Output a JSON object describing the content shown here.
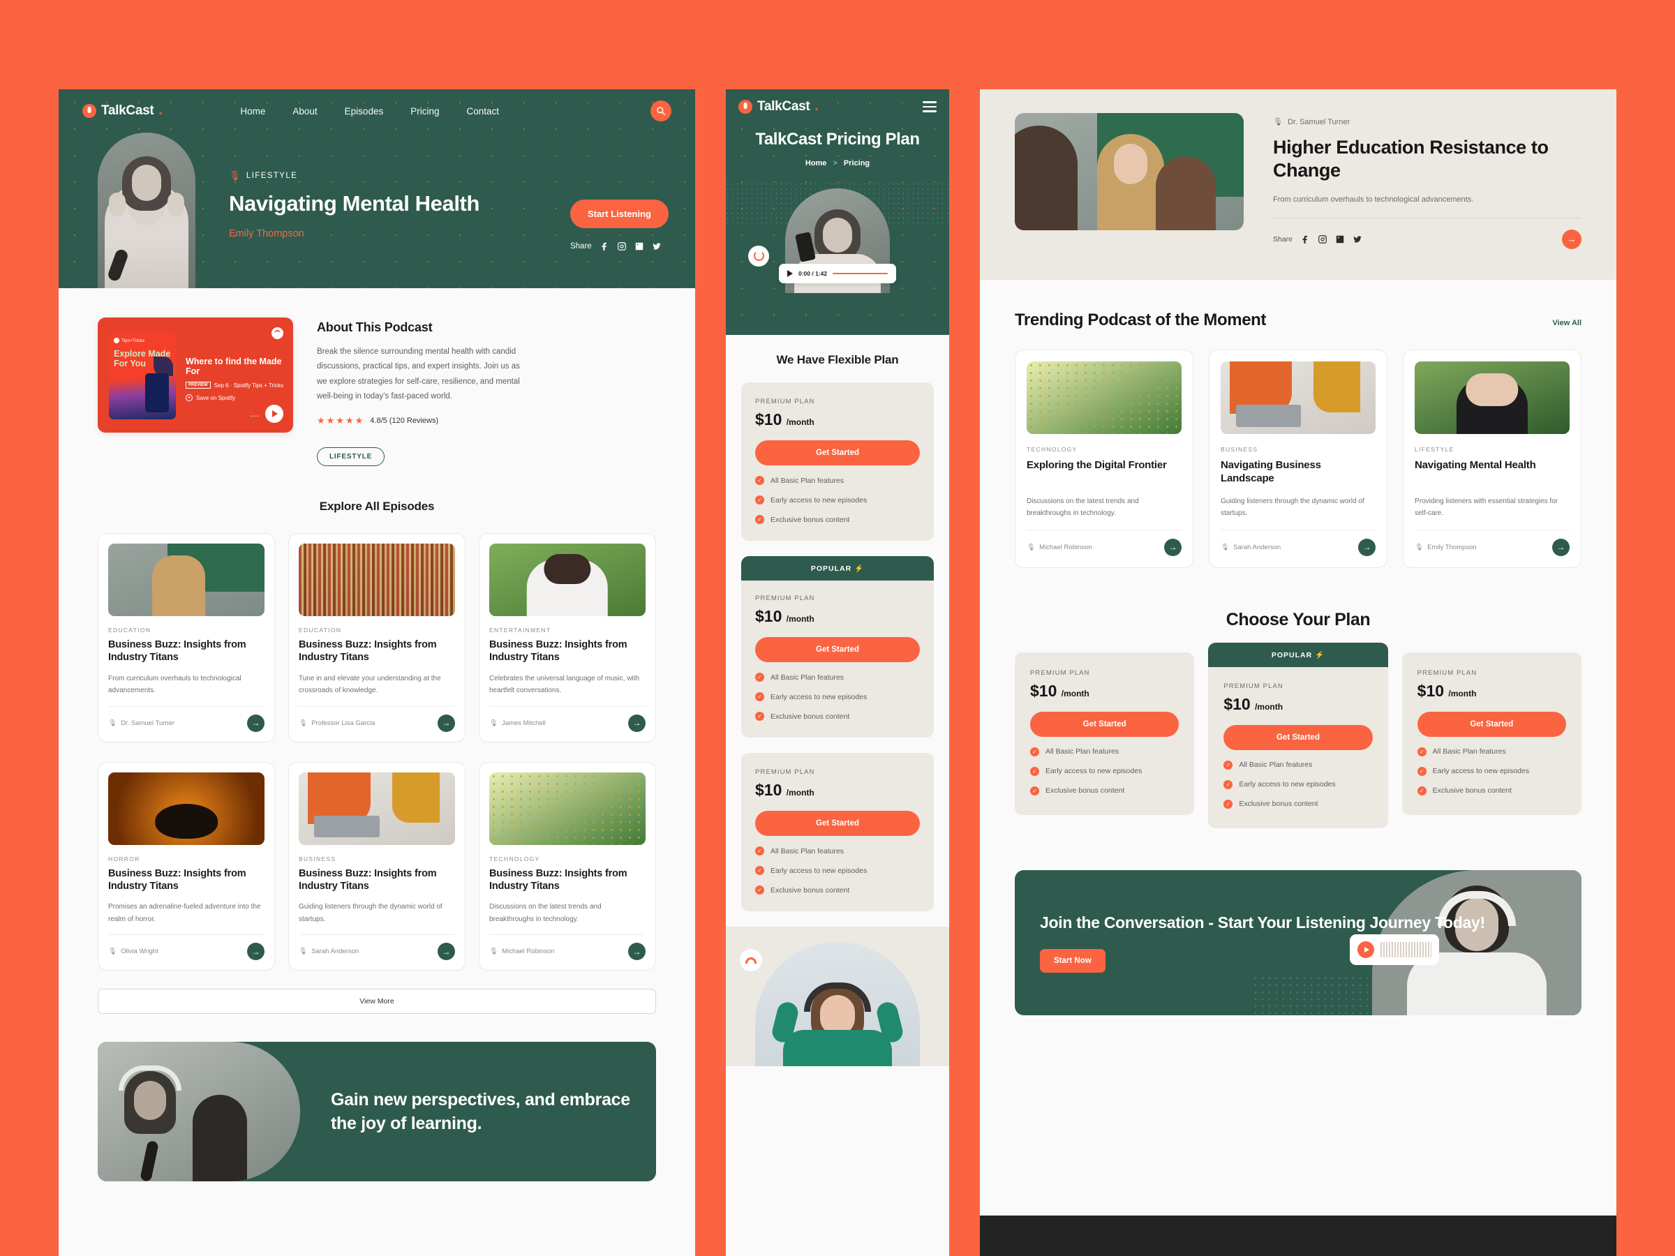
{
  "colors": {
    "background": "#fa6440",
    "green": "#2e5b4e",
    "orange": "#fa6440",
    "cream": "#ece8e2"
  },
  "left": {
    "brand": "TalkCast",
    "brand_dot": ".",
    "nav": [
      "Home",
      "About",
      "Episodes",
      "Pricing",
      "Contact"
    ],
    "search_icon": "search-icon",
    "hero": {
      "eyebrow": "LIFESTYLE",
      "title": "Navigating Mental Health",
      "author": "Emily Thompson",
      "cta": "Start Listening",
      "share_label": "Share"
    },
    "about": {
      "heading": "About This Podcast",
      "body": "Break the silence surrounding mental health with candid discussions, practical tips, and expert insights. Join us as we explore strategies for self-care, resilience, and mental well-being in today's fast-paced world.",
      "stars": "★★★★★",
      "rating": "4.8/5 (120 Reviews)",
      "chip": "LIFESTYLE"
    },
    "spotify": {
      "tips_label": "Tips+Tricks",
      "art_title": "Explore Made For You",
      "episode_title": "Where to find the Made For",
      "preview_badge": "PREVIEW",
      "meta": "Sep 6 · Spotify Tips + Tricks",
      "save": "Save on Spotify",
      "dots": "..."
    },
    "episodes_heading": "Explore All Episodes",
    "episodes": [
      {
        "cat": "EDUCATION",
        "title": "Business Buzz: Insights from Industry Titans",
        "desc": "From curriculum overhauls to technological advancements.",
        "host": "Dr. Samuel Turner",
        "thumb": "t-class"
      },
      {
        "cat": "EDUCATION",
        "title": "Business Buzz: Insights from Industry Titans",
        "desc": "Tune in and elevate your understanding at the crossroads of knowledge.",
        "host": "Professor Lisa Garcia",
        "thumb": "t-lib"
      },
      {
        "cat": "ENTERTAINMENT",
        "title": "Business Buzz: Insights from Industry Titans",
        "desc": "Celebrates the universal language of music, with heartfelt conversations.",
        "host": "James Mitchell",
        "thumb": "t-hp"
      },
      {
        "cat": "HORROR",
        "title": "Business Buzz: Insights from Industry Titans",
        "desc": "Promises an adrenaline-fueled adventure into the realm of horror.",
        "host": "Olivia Wright",
        "thumb": "t-pk"
      },
      {
        "cat": "BUSINESS",
        "title": "Business Buzz: Insights from Industry Titans",
        "desc": "Guiding listeners through the dynamic world of startups.",
        "host": "Sarah Anderson",
        "thumb": "t-biz"
      },
      {
        "cat": "TECHNOLOGY",
        "title": "Business Buzz: Insights from Industry Titans",
        "desc": "Discussions on the latest trends and breakthroughs in technology.",
        "host": "Michael Robinson",
        "thumb": "t-tech"
      }
    ],
    "view_more": "View More",
    "perspective": "Gain new perspectives, and embrace the joy of learning."
  },
  "mobile": {
    "brand": "TalkCast",
    "menu_icon": "hamburger-menu-icon",
    "title": "TalkCast Pricing Plan",
    "breadcrumb": {
      "home": "Home",
      "sep": ">",
      "current": "Pricing"
    },
    "player": {
      "time": "0:00 / 1:42",
      "play_icon": "play-icon",
      "replay_icon": "replay-icon"
    },
    "section_title": "We Have Flexible Plan",
    "popular_label": "POPULAR",
    "popular_bolt": "⚡",
    "plans": [
      {
        "label": "PREMIUM PLAN",
        "price": "$10",
        "period": "/month",
        "cta": "Get Started",
        "popular": false,
        "features": [
          "All Basic Plan features",
          "Early access to new episodes",
          "Exclusive bonus content"
        ]
      },
      {
        "label": "PREMIUM PLAN",
        "price": "$10",
        "period": "/month",
        "cta": "Get Started",
        "popular": true,
        "features": [
          "All Basic Plan features",
          "Early access to new episodes",
          "Exclusive bonus content"
        ]
      },
      {
        "label": "PREMIUM PLAN",
        "price": "$10",
        "period": "/month",
        "cta": "Get Started",
        "popular": false,
        "features": [
          "All Basic Plan features",
          "Early access to new episodes",
          "Exclusive bonus content"
        ]
      }
    ]
  },
  "right": {
    "hero": {
      "host": "Dr. Samuel Turner",
      "title": "Higher Education Resistance to Change",
      "subtitle": "From curriculum overhauls to technological advancements.",
      "share_label": "Share",
      "arrow_icon": "arrow-right-icon"
    },
    "trending": {
      "heading": "Trending Podcast of the Moment",
      "view_all": "View All",
      "cards": [
        {
          "cat": "TECHNOLOGY",
          "title": "Exploring the Digital Frontier",
          "desc": "Discussions on the latest trends and breakthroughs in technology.",
          "host": "Michael Robinson",
          "thumb": "t-tech"
        },
        {
          "cat": "BUSINESS",
          "title": "Navigating Business Landscape",
          "desc": "Guiding listeners through the dynamic world of startups.",
          "host": "Sarah Anderson",
          "thumb": "t-biz"
        },
        {
          "cat": "LIFESTYLE",
          "title": "Navigating Mental Health",
          "desc": "Providing listeners with essential strategies for self-care.",
          "host": "Emily Thompson",
          "thumb": "t-mh"
        }
      ]
    },
    "plans_heading": "Choose Your Plan",
    "popular_label": "POPULAR",
    "popular_bolt": "⚡",
    "plans": [
      {
        "label": "PREMIUM PLAN",
        "price": "$10",
        "period": "/month",
        "cta": "Get Started",
        "popular": false,
        "features": [
          "All Basic Plan features",
          "Early access to new episodes",
          "Exclusive bonus content"
        ]
      },
      {
        "label": "PREMIUM PLAN",
        "price": "$10",
        "period": "/month",
        "cta": "Get Started",
        "popular": true,
        "features": [
          "All Basic Plan features",
          "Early access to new episodes",
          "Exclusive bonus content"
        ]
      },
      {
        "label": "PREMIUM PLAN",
        "price": "$10",
        "period": "/month",
        "cta": "Get Started",
        "popular": false,
        "features": [
          "All Basic Plan features",
          "Early access to new episodes",
          "Exclusive bonus content"
        ]
      }
    ],
    "cta": {
      "title": "Join the Conversation - Start Your Listening Journey Today!",
      "button": "Start Now",
      "play_icon": "play-icon"
    }
  }
}
